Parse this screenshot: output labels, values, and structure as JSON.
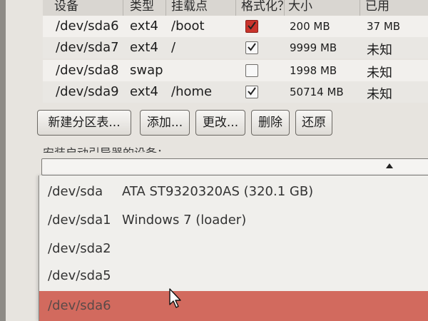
{
  "table": {
    "headers": [
      "设备",
      "类型",
      "挂载点",
      "格式化？",
      "大小",
      "已用"
    ],
    "rows": [
      {
        "device": "/dev/sda6",
        "type": "ext4",
        "mount": "/boot",
        "format": true,
        "format_style": "red",
        "size": "200 MB",
        "used": "37 MB"
      },
      {
        "device": "/dev/sda7",
        "type": "ext4",
        "mount": "/",
        "format": true,
        "format_style": "normal",
        "size": "9999 MB",
        "used": "未知"
      },
      {
        "device": "/dev/sda8",
        "type": "swap",
        "mount": "",
        "format": false,
        "format_style": "normal",
        "size": "1998 MB",
        "used": "未知"
      },
      {
        "device": "/dev/sda9",
        "type": "ext4",
        "mount": "/home",
        "format": true,
        "format_style": "normal",
        "size": "50714 MB",
        "used": "未知"
      }
    ]
  },
  "buttons": {
    "new_table": "新建分区表...",
    "add": "添加...",
    "change": "更改...",
    "delete": "删除",
    "revert": "还原"
  },
  "bootloader_label": "安装启动引导器的设备：",
  "dropdown": {
    "items": [
      {
        "device": "/dev/sda",
        "description": "ATA ST9320320AS (320.1 GB)"
      },
      {
        "device": "/dev/sda1",
        "description": "Windows 7 (loader)"
      },
      {
        "device": "/dev/sda2",
        "description": ""
      },
      {
        "device": "/dev/sda5",
        "description": ""
      },
      {
        "device": "/dev/sda6",
        "description": ""
      }
    ],
    "selected_index": 4
  },
  "colors": {
    "selection": "#d26a5e",
    "checkbox_checked_red": "#c9342c"
  }
}
